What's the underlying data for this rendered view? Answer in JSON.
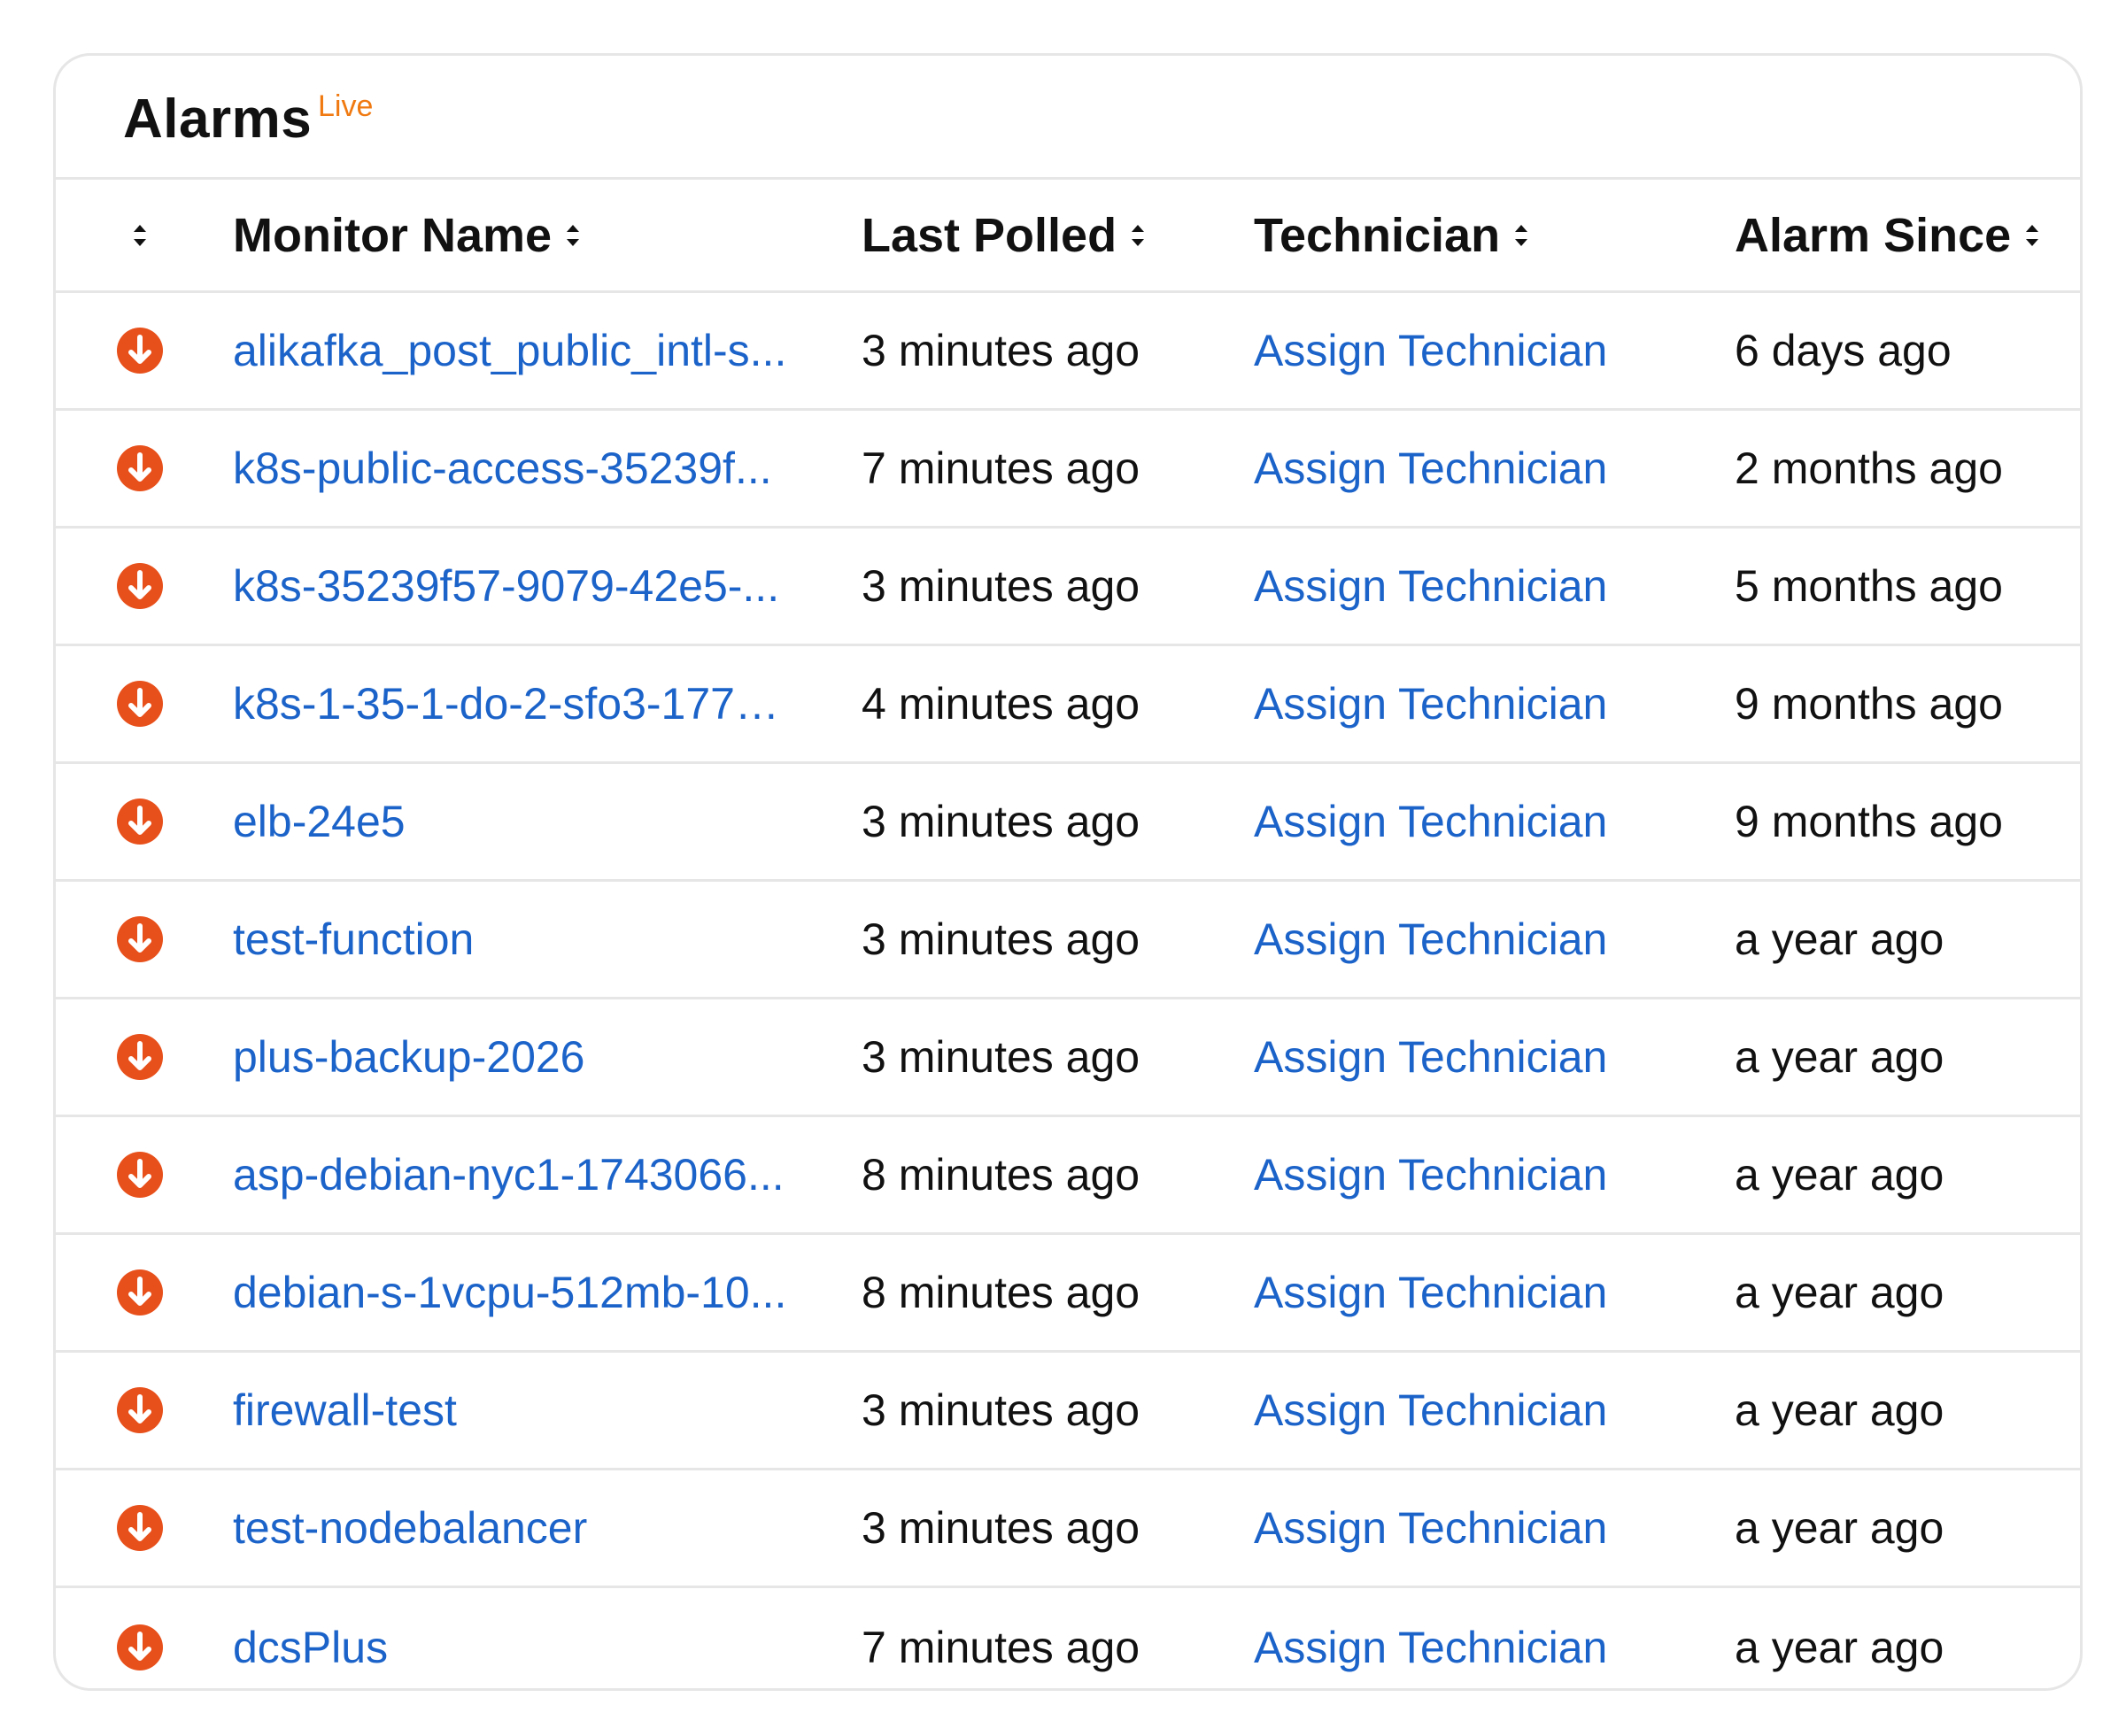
{
  "header": {
    "title": "Alarms",
    "badge": "Live"
  },
  "table": {
    "columns": [
      "Monitor Name",
      "Last Polled",
      "Technician",
      "Alarm Since"
    ],
    "rows": [
      {
        "name": "alikafka_post_public_intl-s...",
        "polled": "3 minutes ago",
        "tech": "Assign Technician",
        "since": "6 days ago"
      },
      {
        "name": "k8s-public-access-35239f...",
        "polled": "7 minutes ago",
        "tech": "Assign Technician",
        "since": "2 months ago"
      },
      {
        "name": "k8s-35239f57-9079-42e5-...",
        "polled": "3 minutes ago",
        "tech": "Assign Technician",
        "since": "5 months ago"
      },
      {
        "name": "k8s-1-35-1-do-2-sfo3-17757...",
        "polled": "4 minutes ago",
        "tech": "Assign Technician",
        "since": "9 months ago"
      },
      {
        "name": "elb-24e5",
        "polled": "3 minutes ago",
        "tech": "Assign Technician",
        "since": "9 months ago"
      },
      {
        "name": "test-function",
        "polled": "3 minutes ago",
        "tech": "Assign Technician",
        "since": "a year ago"
      },
      {
        "name": "plus-backup-2026",
        "polled": "3 minutes ago",
        "tech": "Assign Technician",
        "since": "a year ago"
      },
      {
        "name": "asp-debian-nyc1-1743066...",
        "polled": "8 minutes ago",
        "tech": "Assign Technician",
        "since": "a year ago"
      },
      {
        "name": "debian-s-1vcpu-512mb-10...",
        "polled": "8 minutes ago",
        "tech": "Assign Technician",
        "since": "a year ago"
      },
      {
        "name": "firewall-test",
        "polled": "3 minutes ago",
        "tech": "Assign Technician",
        "since": "a year ago"
      },
      {
        "name": "test-nodebalancer",
        "polled": "3 minutes ago",
        "tech": "Assign Technician",
        "since": "a year ago"
      },
      {
        "name": "dcsPlus",
        "polled": "7 minutes ago",
        "tech": "Assign Technician",
        "since": "a year ago"
      }
    ]
  },
  "colors": {
    "accent_link": "#1c63c9",
    "alarm_down": "#e8501b",
    "live_badge": "#f07a11"
  },
  "icons": {
    "status": "arrow-down-circle-icon",
    "sort": "sort-updown-icon"
  }
}
